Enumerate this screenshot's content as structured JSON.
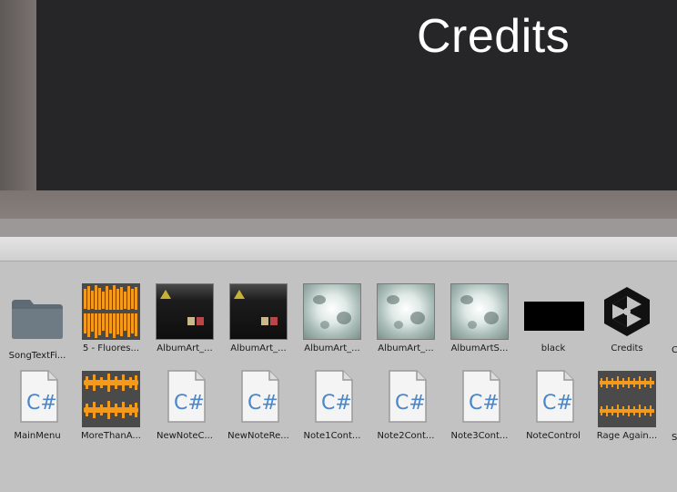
{
  "game_view": {
    "title": "Credits"
  },
  "project": {
    "row1": [
      {
        "label": "SongTextFi...",
        "kind": "folder"
      },
      {
        "label": "5 - Fluores...",
        "kind": "audio"
      },
      {
        "label": "AlbumArt_...",
        "kind": "art-dark"
      },
      {
        "label": "AlbumArt_...",
        "kind": "art-dark"
      },
      {
        "label": "AlbumArt_...",
        "kind": "art-light"
      },
      {
        "label": "AlbumArt_...",
        "kind": "art-light"
      },
      {
        "label": "AlbumArtS...",
        "kind": "art-light"
      },
      {
        "label": "black",
        "kind": "black"
      },
      {
        "label": "Credits",
        "kind": "unity-scene"
      }
    ],
    "row2": [
      {
        "label": "MainMenu",
        "kind": "cs-script"
      },
      {
        "label": "MoreThanA...",
        "kind": "audio"
      },
      {
        "label": "NewNoteC...",
        "kind": "cs-script"
      },
      {
        "label": "NewNoteRe...",
        "kind": "cs-script"
      },
      {
        "label": "Note1Cont...",
        "kind": "cs-script"
      },
      {
        "label": "Note2Cont...",
        "kind": "cs-script"
      },
      {
        "label": "Note3Cont...",
        "kind": "cs-script"
      },
      {
        "label": "NoteControl",
        "kind": "cs-script"
      },
      {
        "label": "Rage Again...",
        "kind": "audio"
      }
    ],
    "row1_partial": "C",
    "row2_partial": "S"
  },
  "colors": {
    "game_bg": "#262628",
    "grid_bg": "#c2c2c2",
    "audio_orange": "#f39a1c",
    "script_blue": "#4a86c8"
  }
}
